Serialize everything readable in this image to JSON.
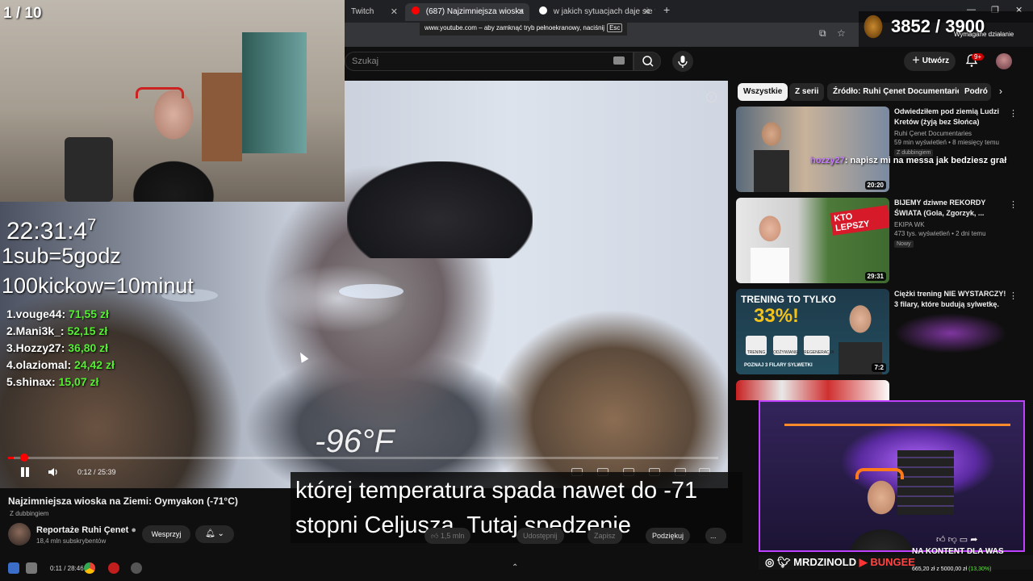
{
  "browser": {
    "tabs": [
      {
        "label": "Twitch",
        "active": false
      },
      {
        "label": "(687) Najzimniejsza wioska",
        "active": true
      },
      {
        "label": "w jakich sytuacjach daje sie fen",
        "active": false
      }
    ],
    "fullscreen_toast": "www.youtube.com – aby zamknąć tryb pełnoekranowy, naciśnij",
    "fullscreen_key": "Esc"
  },
  "youtube": {
    "search_placeholder": "Szukaj",
    "create_label": "Utwórz",
    "notifications_badge": "9+",
    "video": {
      "title": "Najzimniejsza wioska na Ziemi: Oymyakon (-71°C)",
      "dubbing_label": "Z dubbingiem",
      "temperature_overlay": "-96°F",
      "time_display": "0:12 / 25:39",
      "progress_fraction": 0.008,
      "subtitle_line1": "której temperatura spada nawet do -71",
      "subtitle_line2": "stopni Celjusza. Tutaj spędzenie"
    },
    "channel": {
      "name": "Reportaże Ruhi Çenet",
      "subscribers": "18,4 mln subskrybentów",
      "support_label": "Wesprzyj"
    },
    "actions": {
      "likes": "1,5 mln",
      "share": "Udostępnij",
      "save": "Zapisz",
      "thanks": "Podziękuj",
      "more": "..."
    },
    "chips": [
      "Wszystkie",
      "Z serii",
      "Źródło: Ruhi Çenet Documentaries",
      "Podró"
    ],
    "recommendations": [
      {
        "title": "Odwiedziłem pod ziemią Ludzi Kretów (żyją bez Słońca)",
        "channel": "Ruhi Çenet Documentaries",
        "meta": "59 min wyświetleń • 8 miesięcy temu",
        "badge": "Z dubbingiem",
        "duration": "20:20"
      },
      {
        "title": "BIJEMY dziwne REKORDY ŚWIATA (Gola, Zgorzyk, ...",
        "channel": "EKIPA WK",
        "meta": "473 tys. wyświetleń • 2 dni temu",
        "badge": "Nowy",
        "duration": "29:31"
      },
      {
        "title": "Ciężki trening NIE WYSTARCZY! 3 filary, które budują sylwetkę.",
        "channel": "",
        "meta": "",
        "badge": "",
        "duration": "7:2"
      },
      {
        "title": "",
        "channel": "",
        "meta": "",
        "badge": "",
        "duration": ""
      }
    ],
    "thumb_texts": {
      "t2": "KTO LEPSZY",
      "t3_head": "TRENING TO TYLKO",
      "t3_pct": "33%!",
      "t3_items": [
        "TRENING",
        "ODŻYWIANIE",
        "REGENERACJA"
      ],
      "t3_foot": "POZNAJ 3 FILARY SYLWETKI"
    }
  },
  "stream": {
    "sub_counter": "1 / 10",
    "clock": "22:31:4",
    "clock_sup": "7",
    "rule1": "1sub=5godz",
    "rule2": "100kickow=10minut",
    "leaderboard": [
      {
        "rank_user": "1.vouge44:",
        "amount": "71,55 zł"
      },
      {
        "rank_user": "2.Mani3k_:",
        "amount": "52,15 zł"
      },
      {
        "rank_user": "3.Hozzy27:",
        "amount": "36,80 zł"
      },
      {
        "rank_user": "4.olaziomal:",
        "amount": "24,42 zł"
      },
      {
        "rank_user": "5.shinax:",
        "amount": "15,07 zł"
      }
    ],
    "goal": "3852 / 3900",
    "goal_sub": "Wymagane działanie",
    "chat_user": "hozzy27",
    "chat_text": ": napisz mi na messa jak bedziesz grał",
    "socials": "MRDZINOLD",
    "socials2": "BUNGEE",
    "promo": "NA KONTENT DLA WAS",
    "donation": "665,20 zł z 5000,00 zł",
    "donation_pct": "(13,30%)",
    "taskbar_time": "0:11 / 28:46"
  },
  "colors": {
    "accent_red": "#ff0000",
    "money_green": "#55ee33",
    "chat_user": "#c57bff"
  }
}
